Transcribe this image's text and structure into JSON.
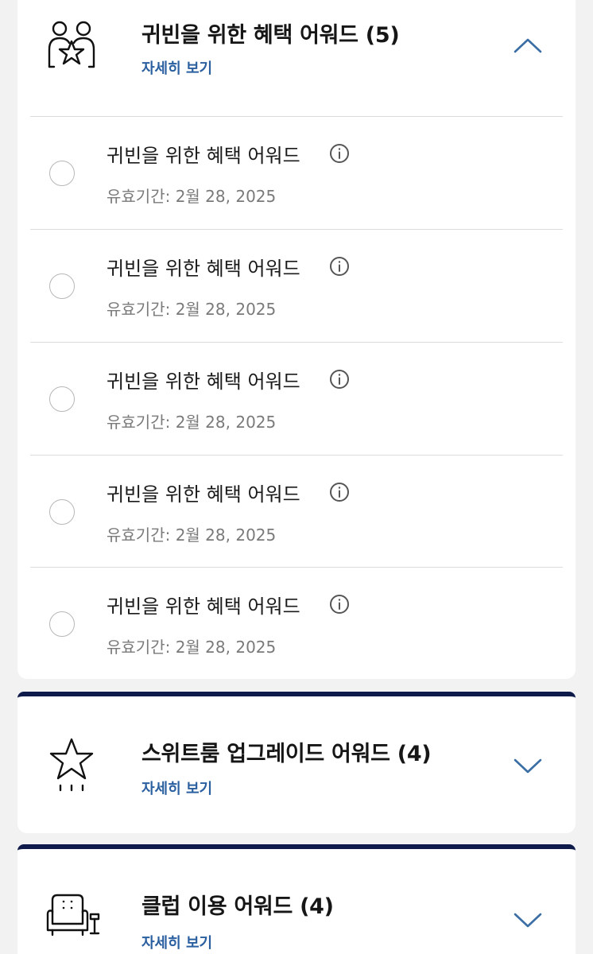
{
  "sections": [
    {
      "icon": "vip-people-star-icon",
      "title": "귀빈을 위한 혜택 어워드 (5)",
      "details_link": "자세히 보기",
      "expanded": true,
      "chevron": "chevron-up-icon",
      "items": [
        {
          "title": "귀빈을 위한 혜택 어워드",
          "expiry": "유효기간: 2월 28, 2025"
        },
        {
          "title": "귀빈을 위한 혜택 어워드",
          "expiry": "유효기간: 2월 28, 2025"
        },
        {
          "title": "귀빈을 위한 혜택 어워드",
          "expiry": "유효기간: 2월 28, 2025"
        },
        {
          "title": "귀빈을 위한 혜택 어워드",
          "expiry": "유효기간: 2월 28, 2025"
        },
        {
          "title": "귀빈을 위한 혜택 어워드",
          "expiry": "유효기간: 2월 28, 2025"
        }
      ]
    },
    {
      "icon": "suite-upgrade-star-icon",
      "title": "스위트룸 업그레이드 어워드 (4)",
      "details_link": "자세히 보기",
      "expanded": false,
      "chevron": "chevron-down-icon"
    },
    {
      "icon": "club-armchair-icon",
      "title": "클럽 이용 어워드 (4)",
      "details_link": "자세히 보기",
      "expanded": false,
      "chevron": "chevron-down-icon"
    }
  ],
  "colors": {
    "accent_link": "#2a5fa0",
    "chevron": "#3a6ea5",
    "card_top_border": "#0d1a4a",
    "background": "#f2f2f3"
  }
}
